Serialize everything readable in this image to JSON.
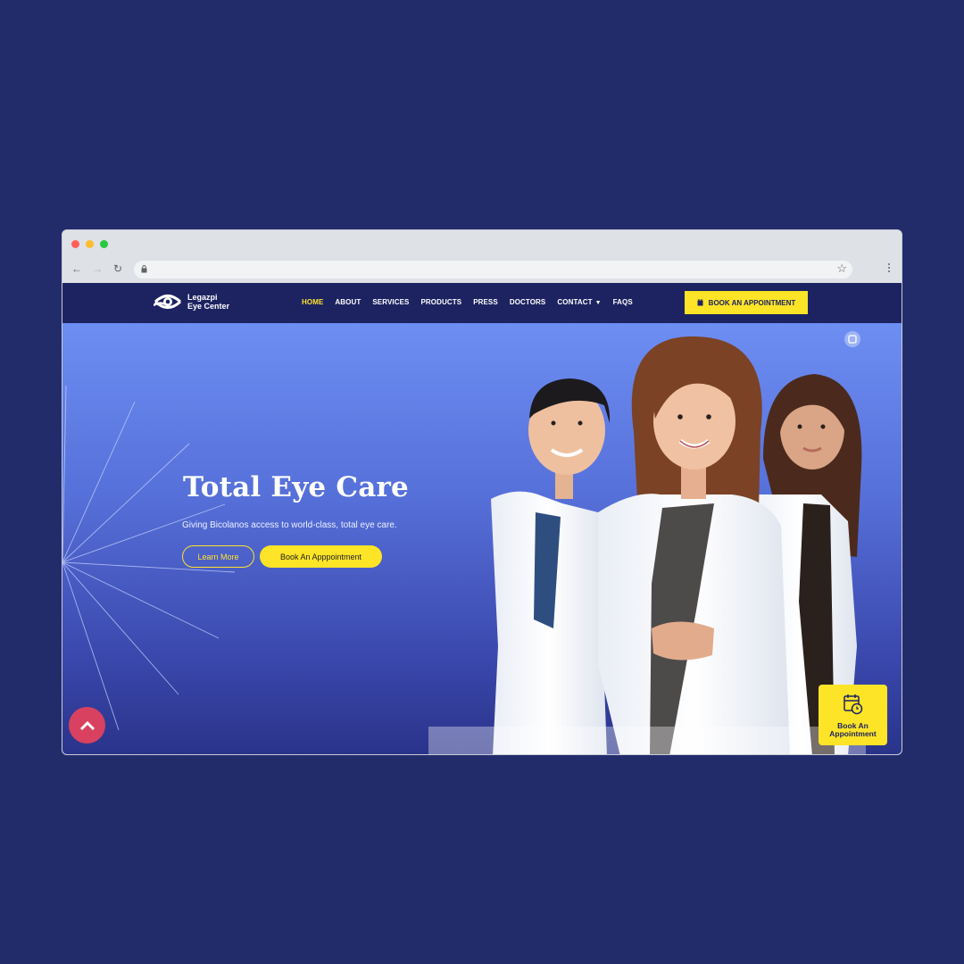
{
  "browser": {
    "traffic_lights": [
      "#ff5f57",
      "#febc2e",
      "#28c840"
    ]
  },
  "site": {
    "logo": {
      "line1": "Legazpi",
      "line2": "Eye Center"
    },
    "menu": [
      {
        "label": "HOME",
        "active": true
      },
      {
        "label": "ABOUT"
      },
      {
        "label": "SERVICES"
      },
      {
        "label": "PRODUCTS"
      },
      {
        "label": "PRESS"
      },
      {
        "label": "DOCTORS"
      },
      {
        "label": "CONTACT",
        "dropdown": true
      },
      {
        "label": "FAQS"
      }
    ],
    "cta_label": "BOOK AN APPOINTMENT"
  },
  "hero": {
    "title": "Total Eye Care",
    "subtitle": "Giving Bicolanos access to world-class, total eye care.",
    "learn_more": "Learn More",
    "book_button": "Book An Apppointment",
    "float_book_label": "Book An Appointment"
  },
  "colors": {
    "nav_bg": "#1d2361",
    "accent_yellow": "#fde427",
    "hero_top": "#6d8ef3",
    "hero_bottom": "#2a3389",
    "scroll_button": "#d94160"
  }
}
